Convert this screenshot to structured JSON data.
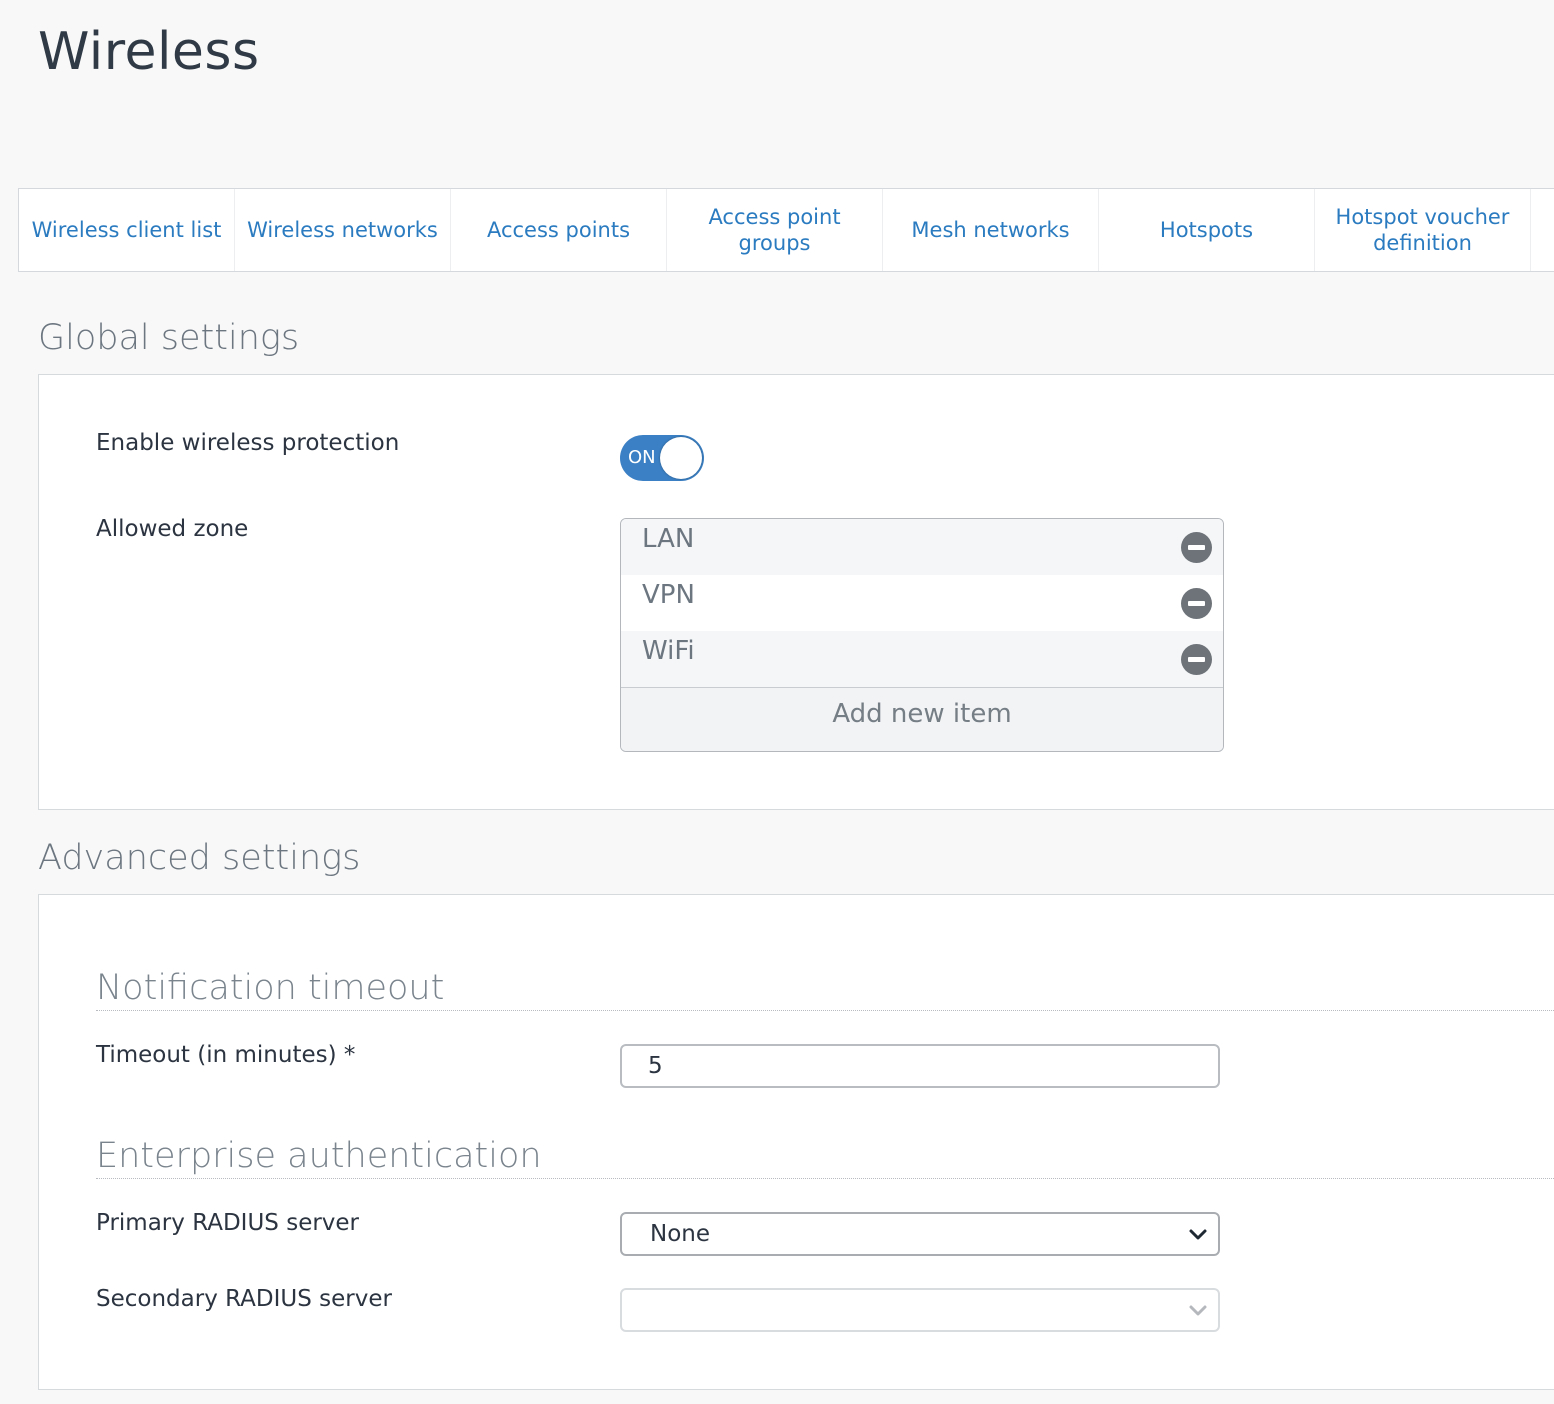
{
  "page": {
    "title": "Wireless"
  },
  "tabs": [
    {
      "label": "Wireless client list"
    },
    {
      "label": "Wireless networks"
    },
    {
      "label": "Access points"
    },
    {
      "label": "Access point groups"
    },
    {
      "label": "Mesh networks"
    },
    {
      "label": "Hotspots"
    },
    {
      "label": "Hotspot voucher definition"
    }
  ],
  "global_settings": {
    "title": "Global settings",
    "enable_label": "Enable wireless protection",
    "toggle": {
      "state": "ON",
      "color": "#3b80c4"
    },
    "allowed_zone_label": "Allowed zone",
    "zones": [
      "LAN",
      "VPN",
      "WiFi"
    ],
    "add_item_label": "Add new item"
  },
  "advanced_settings": {
    "title": "Advanced settings",
    "notification": {
      "title": "Notification timeout",
      "timeout_label": "Timeout (in minutes) *",
      "timeout_value": "5"
    },
    "enterprise": {
      "title": "Enterprise authentication",
      "primary_label": "Primary RADIUS server",
      "primary_value": "None",
      "secondary_label": "Secondary RADIUS server",
      "secondary_value": ""
    }
  },
  "colors": {
    "link": "#2a7bc0",
    "accent": "#3b80c4",
    "background": "#f8f8f8"
  }
}
